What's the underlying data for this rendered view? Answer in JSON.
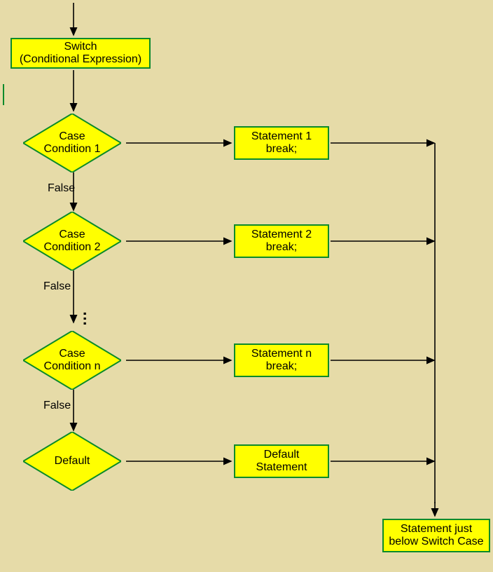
{
  "switch": {
    "line1": "Switch",
    "line2": "(Conditional Expression)"
  },
  "case1": {
    "line1": "Case",
    "line2": "Condition 1",
    "stmt1": "Statement 1",
    "stmt2": "break;",
    "false": "False"
  },
  "case2": {
    "line1": "Case",
    "line2": "Condition 2",
    "stmt1": "Statement 2",
    "stmt2": "break;",
    "false": "False"
  },
  "caseN": {
    "line1": "Case",
    "line2": "Condition n",
    "stmt1": "Statement n",
    "stmt2": "break;",
    "false": "False"
  },
  "default": {
    "label": "Default",
    "stmt1": "Default",
    "stmt2": "Statement"
  },
  "final": {
    "line1": "Statement just",
    "line2": "below Switch Case"
  }
}
